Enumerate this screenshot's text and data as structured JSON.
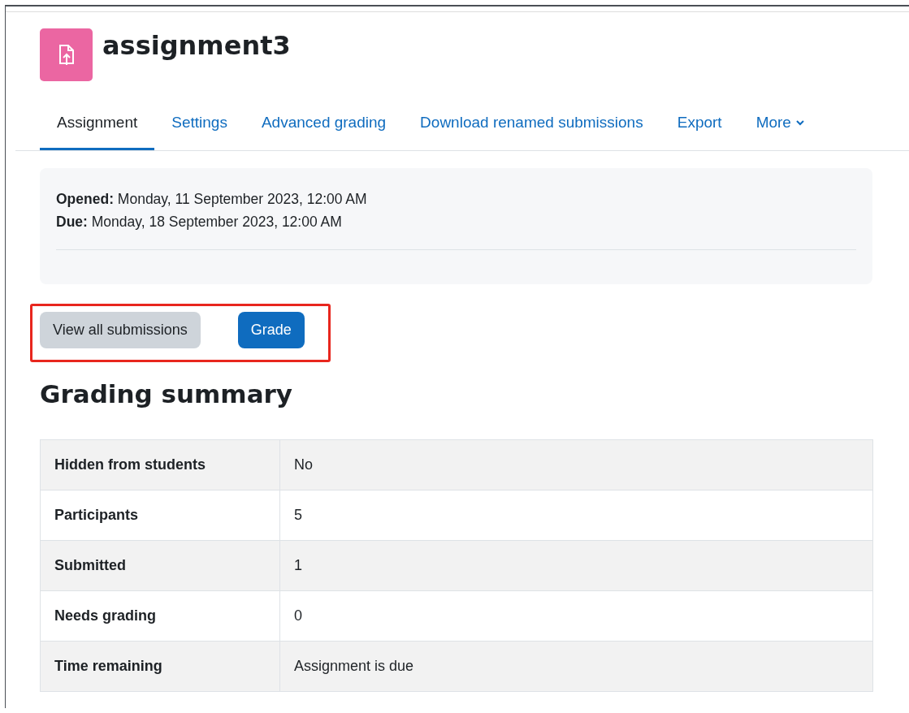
{
  "title": "assignment3",
  "tabs": [
    {
      "label": "Assignment",
      "selected": true
    },
    {
      "label": "Settings",
      "selected": false
    },
    {
      "label": "Advanced grading",
      "selected": false
    },
    {
      "label": "Download renamed submissions",
      "selected": false
    },
    {
      "label": "Export",
      "selected": false
    },
    {
      "label": "More",
      "selected": false,
      "kind": "menu"
    }
  ],
  "dates": [
    {
      "label": "Opened:",
      "value": "Monday, 11 September 2023, 12:00 AM"
    },
    {
      "label": "Due:",
      "value": "Monday, 18 September 2023, 12:00 AM"
    }
  ],
  "buttons": [
    {
      "label": "View all submissions",
      "kind": "secondary"
    },
    {
      "label": "Grade",
      "kind": "primary"
    }
  ],
  "summary_heading": "Grading summary",
  "summary": [
    {
      "label": "Hidden from students",
      "value": "No"
    },
    {
      "label": "Participants",
      "value": "5"
    },
    {
      "label": "Submitted",
      "value": "1"
    },
    {
      "label": "Needs grading",
      "value": "0"
    },
    {
      "label": "Time remaining",
      "value": "Assignment is due"
    }
  ]
}
